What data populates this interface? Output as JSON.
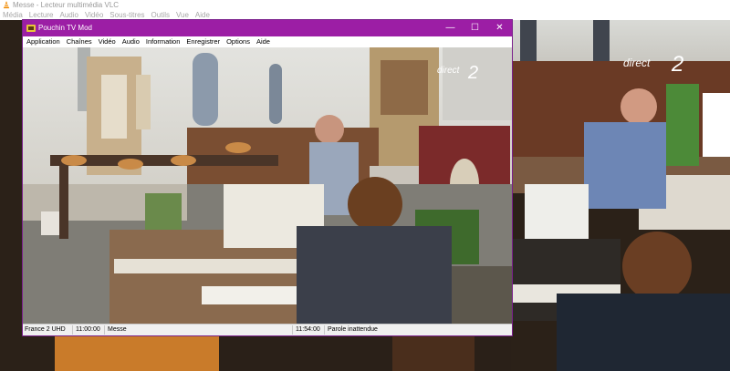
{
  "vlc": {
    "window_title": "Messe - Lecteur multimédia VLC",
    "menu": [
      "Média",
      "Lecture",
      "Audio",
      "Vidéo",
      "Sous-titres",
      "Outils",
      "Vue",
      "Aide"
    ]
  },
  "channel_logo": {
    "word": "direct",
    "number": "2"
  },
  "pouchin": {
    "title": "Pouchin TV Mod",
    "controls": {
      "minimize": "—",
      "maximize": "☐",
      "close": "✕"
    },
    "menu": [
      "Application",
      "Chaînes",
      "Vidéo",
      "Audio",
      "Information",
      "Enregistrer",
      "Options",
      "Aide"
    ],
    "status": {
      "channel": "France 2 UHD",
      "start_time": "11:00:00",
      "program": "Messe",
      "end_time": "11:54:00",
      "next_program": "Parole inattendue"
    }
  },
  "colors": {
    "pouchin_title_bar": "#9c1ea5",
    "vlc_chrome": "#ffffff"
  }
}
